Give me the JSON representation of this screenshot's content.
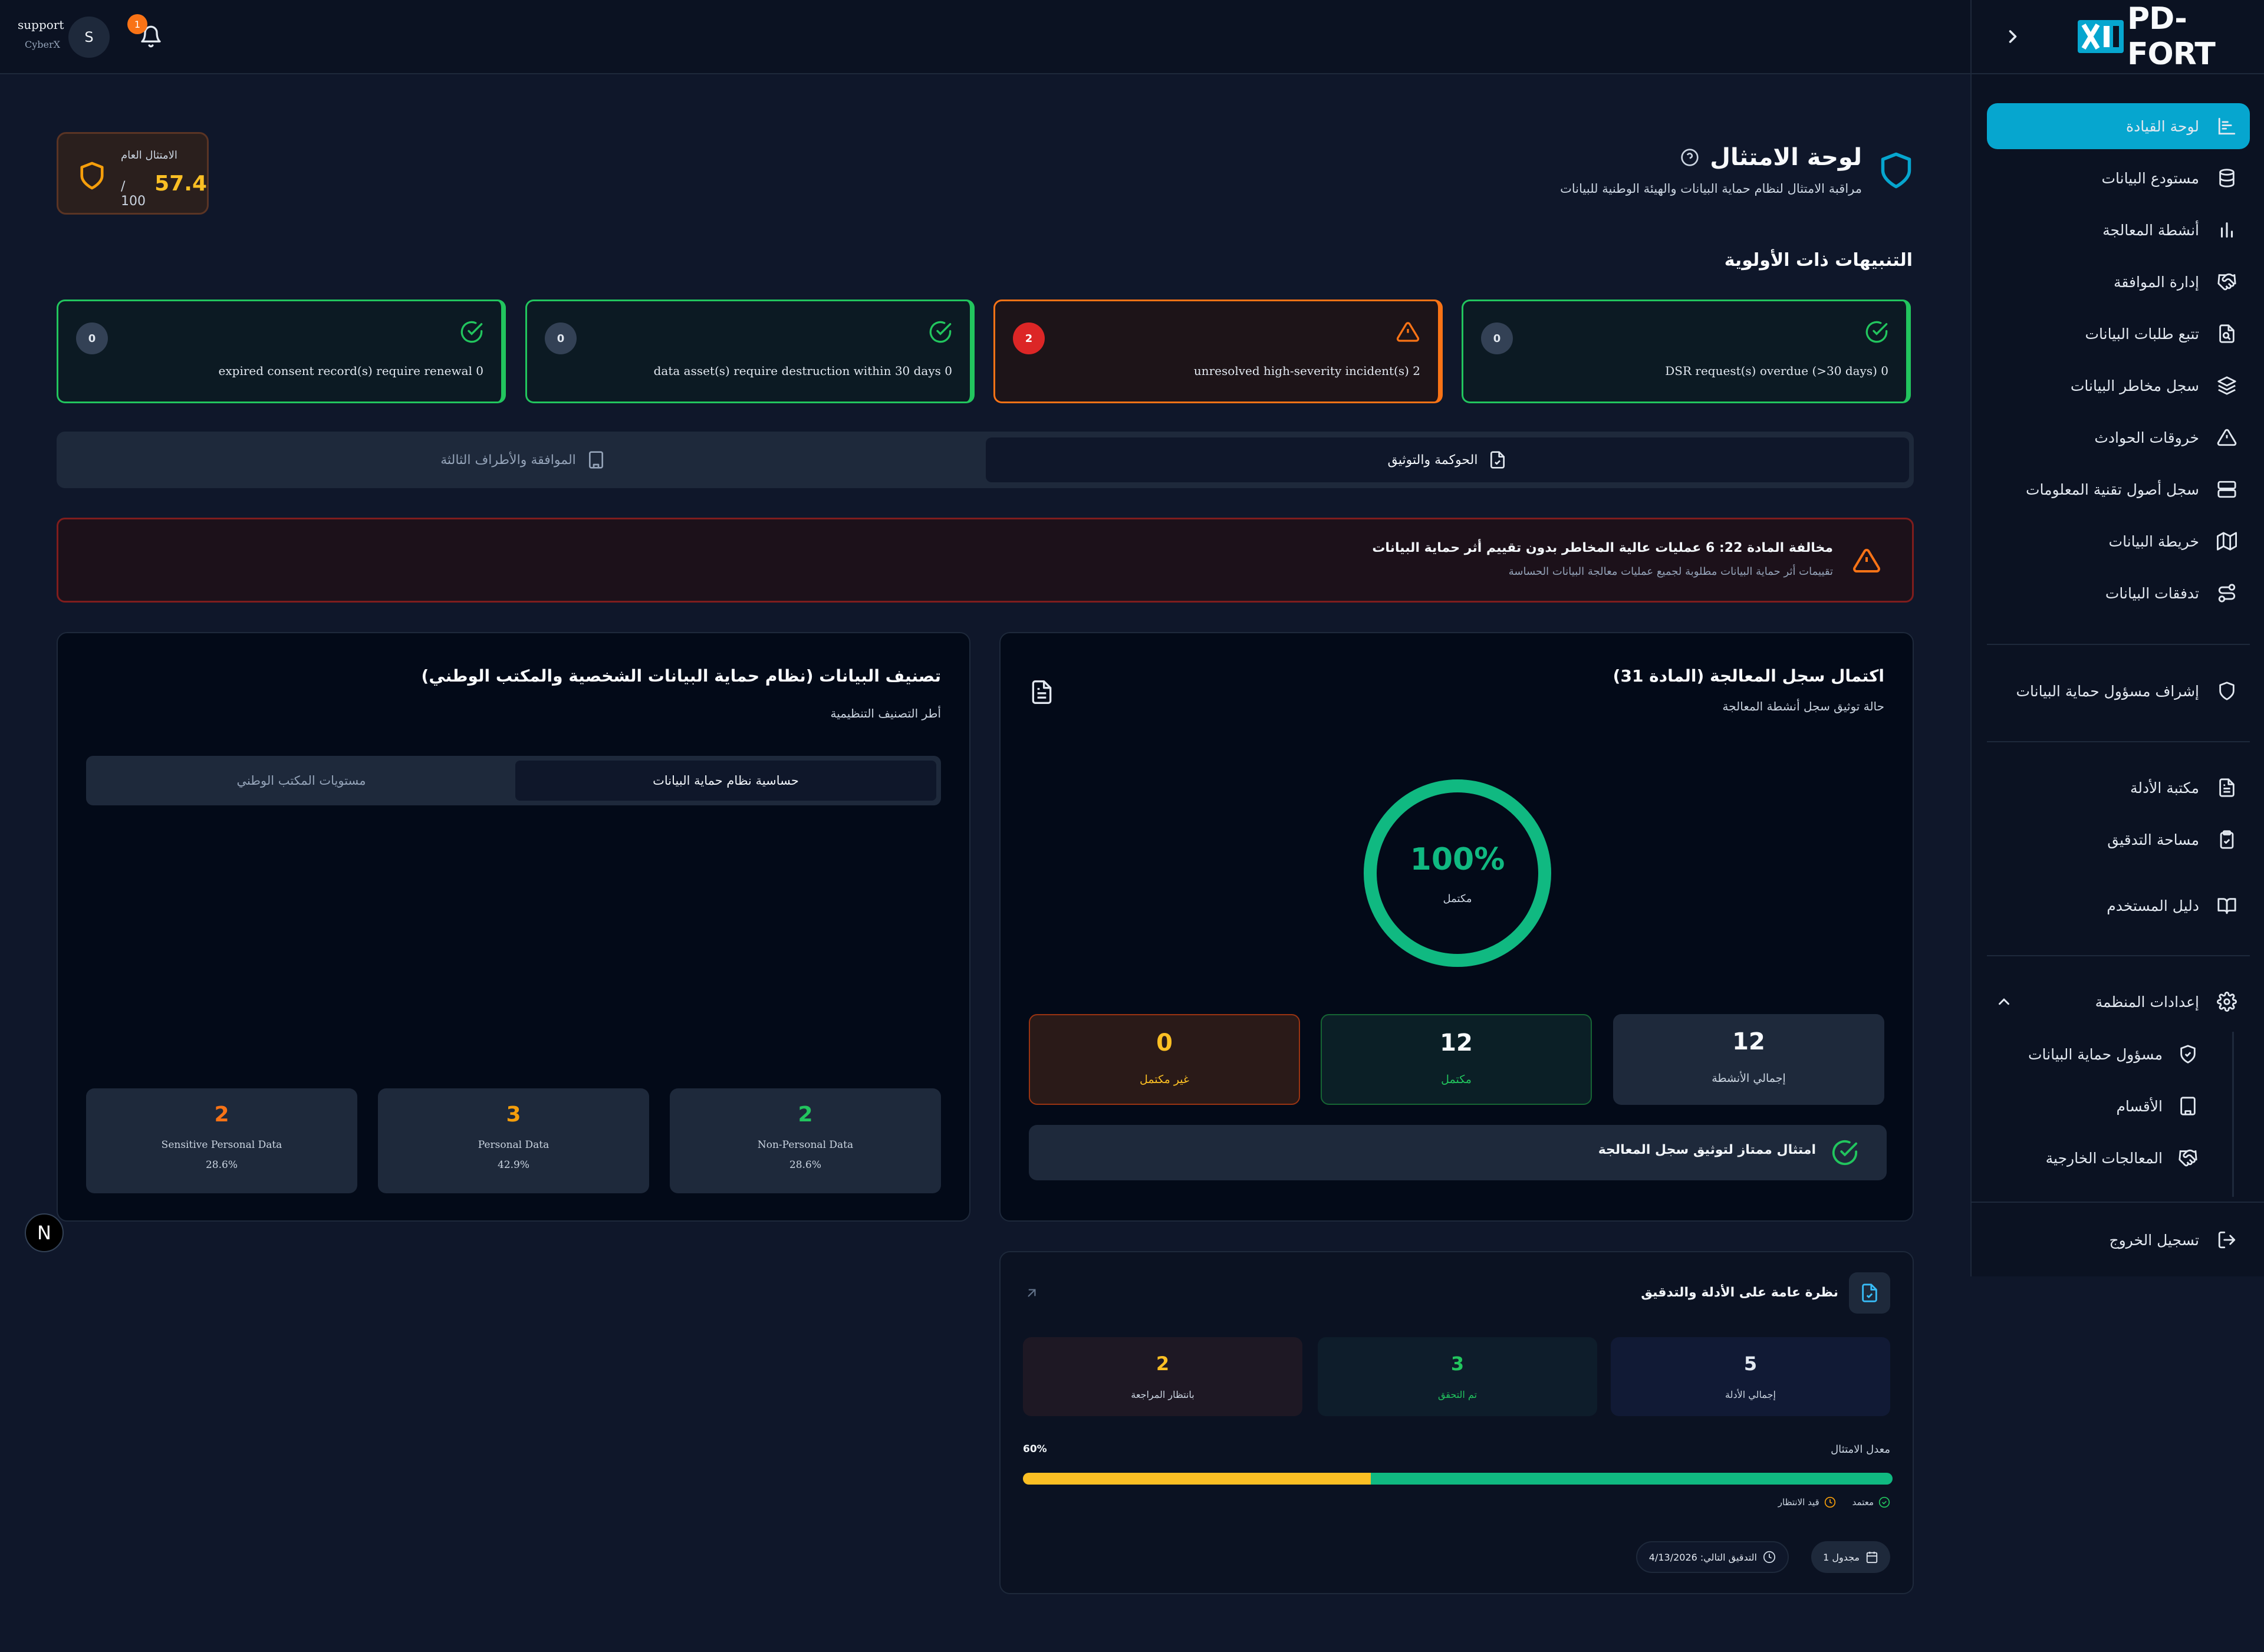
{
  "brand": {
    "logo_text": "PD-FORT"
  },
  "topbar": {
    "user_name": "support",
    "org_name": "CyberX",
    "avatar_letter": "S",
    "notification_count": "1"
  },
  "sidebar": {
    "items": [
      {
        "label": "لوحة القيادة",
        "icon": "dashboard-icon"
      },
      {
        "label": "مستودع البيانات",
        "icon": "database-icon"
      },
      {
        "label": "أنشطة المعالجة",
        "icon": "bar-chart-icon"
      },
      {
        "label": "إدارة الموافقة",
        "icon": "handshake-icon"
      },
      {
        "label": "تتبع طلبات البيانات",
        "icon": "file-search-icon"
      },
      {
        "label": "سجل مخاطر البيانات",
        "icon": "layers-icon"
      },
      {
        "label": "خروقات الحوادث",
        "icon": "warning-icon"
      },
      {
        "label": "سجل أصول تقنية المعلومات",
        "icon": "server-icon"
      },
      {
        "label": "خريطة البيانات",
        "icon": "map-icon"
      },
      {
        "label": "تدفقات البيانات",
        "icon": "route-icon"
      }
    ],
    "dpo_item": {
      "label": "إشراف مسؤول حماية البيانات",
      "icon": "shield-icon"
    },
    "tools": [
      {
        "label": "مكتبة الأدلة",
        "icon": "document-icon"
      },
      {
        "label": "مساحة التدقيق",
        "icon": "clipboard-check-icon"
      },
      {
        "label": "دليل المستخدم",
        "icon": "book-icon"
      }
    ],
    "org_settings": {
      "label": "إعدادات المنظمة",
      "children": [
        {
          "label": "مسؤول حماية البيانات",
          "icon": "shield-check-icon"
        },
        {
          "label": "الأقسام",
          "icon": "building-icon"
        },
        {
          "label": "المعالجات الخارجية",
          "icon": "handshake-icon"
        }
      ]
    },
    "logout": "تسجيل الخروج"
  },
  "header": {
    "title": "لوحة الامتثال",
    "subtitle": "مراقبة الامتثال لنظام حماية البيانات والهيئة الوطنية للبيانات",
    "score_label": "الامتثال العام",
    "score_value": "57.4",
    "score_max": "/ 100"
  },
  "priority": {
    "title": "التنبيهات ذات الأولوية",
    "cards": [
      {
        "count": "0",
        "text": "DSR request(s) overdue (>30 days) 0",
        "status": "ok"
      },
      {
        "count": "2",
        "text": "unresolved high-severity incident(s) 2",
        "status": "alert"
      },
      {
        "count": "0",
        "text": "data asset(s) require destruction within 30 days 0",
        "status": "ok"
      },
      {
        "count": "0",
        "text": "expired consent record(s) require renewal 0",
        "status": "ok"
      }
    ]
  },
  "tabs": {
    "governance": "الحوكمة والتوثيق",
    "consent": "الموافقة والأطراف الثالثة"
  },
  "warning": {
    "title": "مخالفة المادة 22: 6 عمليات عالية المخاطر بدون تقييم أثر حماية البيانات",
    "detail": "تقييمات أثر حماية البيانات مطلوبة لجميع عمليات معالجة البيانات الحساسة"
  },
  "ropa": {
    "title": "اكتمال سجل المعالجة (المادة 31)",
    "subtitle": "حالة توثيق سجل أنشطة المعالجة",
    "percent_text": "100%",
    "completion_fraction": 1.0,
    "status_label": "مكتمل",
    "stats": [
      {
        "value": "12",
        "label": "إجمالي الأنشطة"
      },
      {
        "value": "12",
        "label": "مكتمل"
      },
      {
        "value": "0",
        "label": "غير مكتمل"
      }
    ],
    "banner": "امتثال ممتاز لتوثيق سجل المعالجة"
  },
  "classification": {
    "title": "تصنيف البيانات (نظام حماية البيانات الشخصية والمكتب الوطني)",
    "subtitle": "أطر التصنيف التنظيمية",
    "seg_active": "حساسية نظام حماية البيانات",
    "seg_other": "مستويات المكتب الوطني",
    "stats": [
      {
        "value": "2",
        "label": "Non-Personal Data",
        "pct": "28.6%",
        "color": "#22c55e"
      },
      {
        "value": "3",
        "label": "Personal Data",
        "pct": "42.9%",
        "color": "#f59e0b"
      },
      {
        "value": "2",
        "label": "Sensitive Personal Data",
        "pct": "28.6%",
        "color": "#f97316"
      }
    ]
  },
  "evidence": {
    "title": "نظرة عامة على الأدلة والتدقيق",
    "stats": [
      {
        "value": "5",
        "label": "إجمالي الأدلة",
        "color": "#e2e8f0"
      },
      {
        "value": "3",
        "label": "تم التحقق",
        "color": "#22c55e"
      },
      {
        "value": "2",
        "label": "بانتظار المراجعة",
        "color": "#f59e0b"
      }
    ],
    "rate_label": "معدل الامتثال",
    "rate_text": "60%",
    "approved_fraction": 0.6,
    "pending_fraction": 0.4,
    "legend_approved": "معتمد",
    "legend_pending": "قيد الانتظار",
    "scheduled": "1 مجدول",
    "next_audit": "التدقيق التالي: 4/13/2026"
  },
  "colors": {
    "accent": "#06a6cf",
    "success": "#22c55e",
    "warning": "#f59e0b",
    "danger": "#ef4444",
    "orange": "#f97316"
  }
}
